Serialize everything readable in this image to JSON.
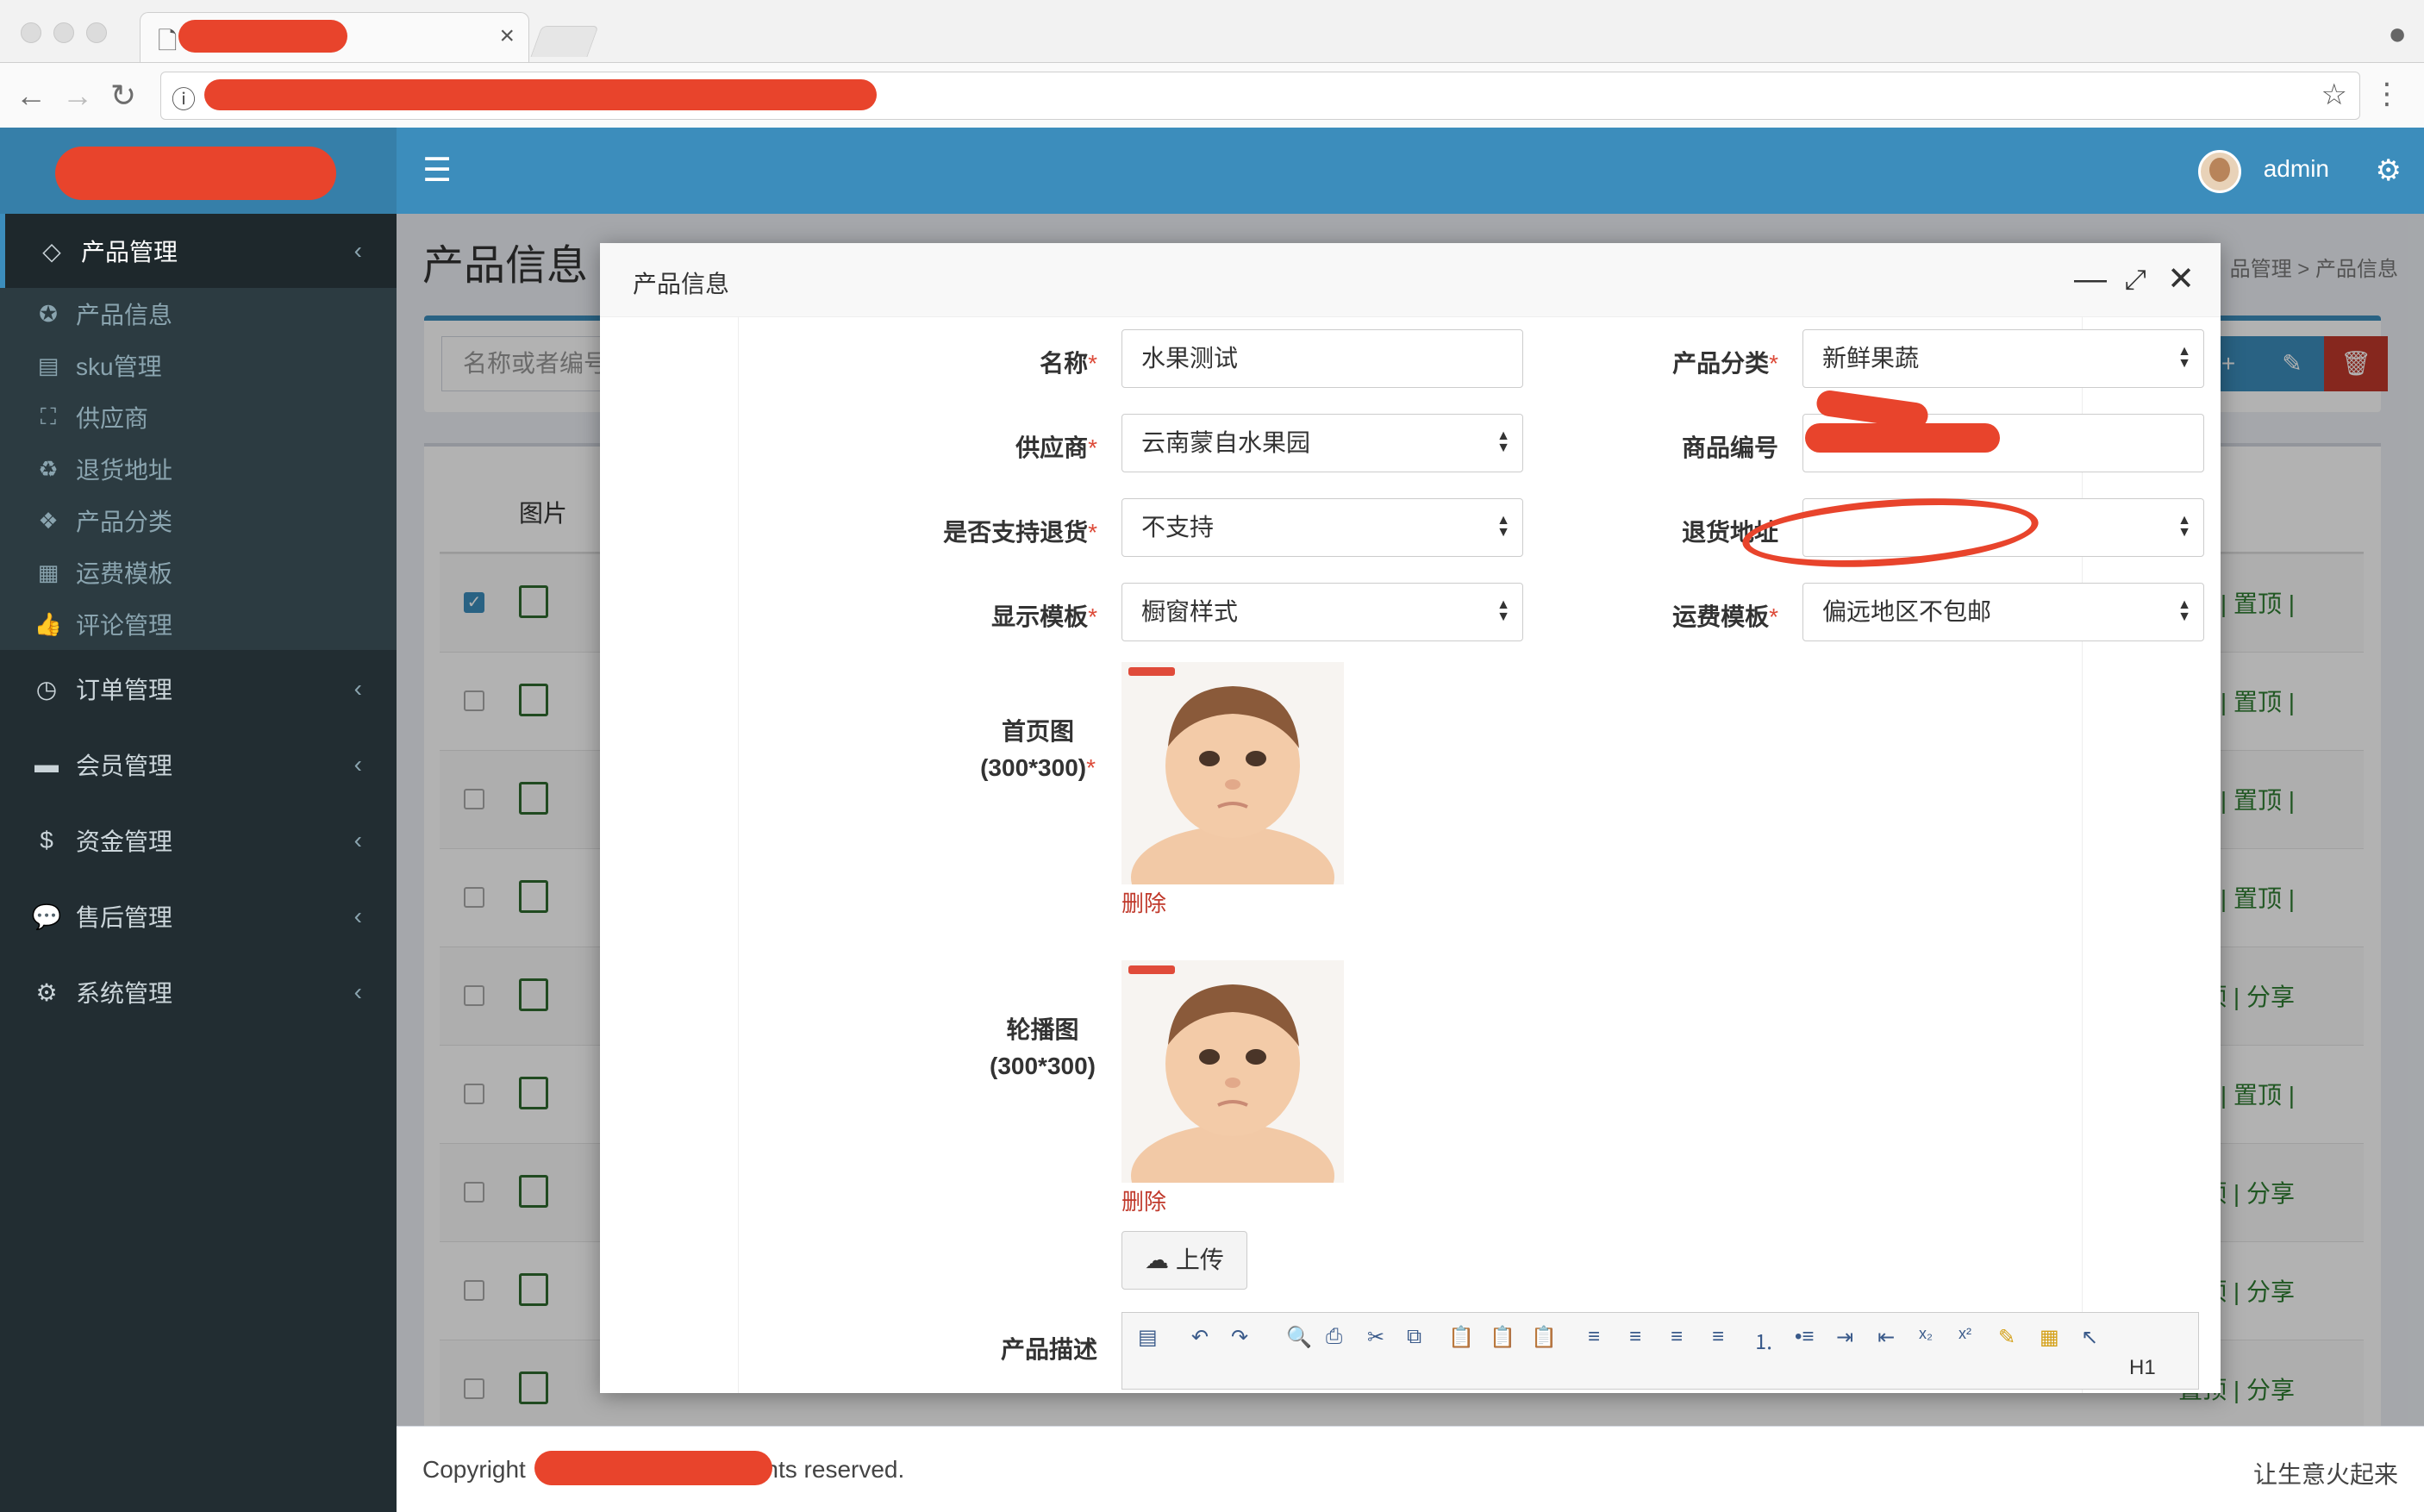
{
  "browser": {
    "close_tab": "×"
  },
  "topbar": {
    "user": "admin"
  },
  "sidebar": {
    "menus": [
      {
        "label": "产品管理",
        "icon": "diamond-icon",
        "active": true
      },
      {
        "label": "订单管理",
        "icon": "clock-icon"
      },
      {
        "label": "会员管理",
        "icon": "archive-icon"
      },
      {
        "label": "资金管理",
        "icon": "dollar-icon"
      },
      {
        "label": "售后管理",
        "icon": "comment-icon"
      },
      {
        "label": "系统管理",
        "icon": "gears-icon"
      }
    ],
    "submenu": [
      {
        "label": "产品信息",
        "icon": "rebel-icon"
      },
      {
        "label": "sku管理",
        "icon": "doc-icon"
      },
      {
        "label": "供应商",
        "icon": "frame-icon"
      },
      {
        "label": "退货地址",
        "icon": "recycle-icon"
      },
      {
        "label": "产品分类",
        "icon": "cubes-icon"
      },
      {
        "label": "运费模板",
        "icon": "table-icon"
      },
      {
        "label": "评论管理",
        "icon": "thumbs-up-icon"
      }
    ]
  },
  "content": {
    "title": "产品信息",
    "breadcrumb": "品管理 > 产品信息",
    "search_placeholder": "名称或者编号",
    "table_col_img": "图片",
    "row_actions": [
      "上架 | 置顶 |",
      "上架 | 置顶 |",
      "上架 | 置顶 |",
      "上架 | 置顶 |",
      "置顶 | 分享",
      "上架 | 置顶 |",
      "置顶 | 分享",
      "置顶 | 分享",
      "置顶 | 分享"
    ]
  },
  "footer": {
    "left": "Copyright",
    "left_tail": "ghts reserved.",
    "right": "让生意火起来"
  },
  "modal": {
    "title": "产品信息",
    "fields": {
      "name_label": "名称",
      "name_value": "水果测试",
      "category_label": "产品分类",
      "category_value": "新鲜果蔬",
      "supplier_label": "供应商",
      "supplier_value": "云南蒙自水果园",
      "code_label": "商品编号",
      "returnable_label": "是否支持退货",
      "returnable_value": "不支持",
      "return_addr_label": "退货地址",
      "display_tpl_label": "显示模板",
      "display_tpl_value": "橱窗样式",
      "shipping_tpl_label": "运费模板",
      "shipping_tpl_value": "偏远地区不包邮",
      "home_img_label": "首页图",
      "home_img_size": "(300*300)",
      "carousel_label": "轮播图",
      "carousel_size": "(300*300)",
      "delete_label": "删除",
      "upload_label": "上传",
      "desc_label": "产品描述",
      "required_mark": "*"
    },
    "editor_heading": "H1"
  }
}
